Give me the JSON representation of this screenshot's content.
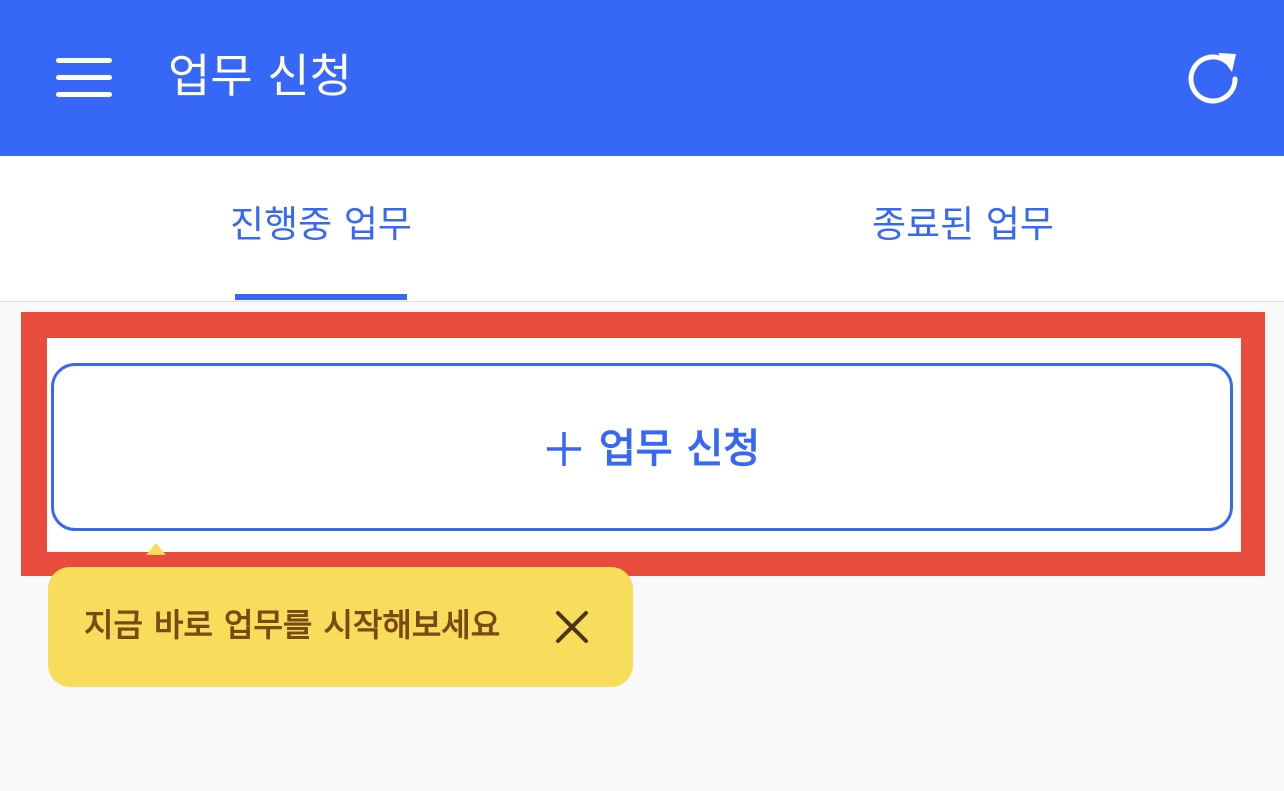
{
  "colors": {
    "primary": "#3767f6",
    "tooltip_background": "#f8dc5c",
    "tooltip_text": "#7a4a15",
    "highlight_frame": "#e74c3c"
  },
  "header": {
    "menu_icon": "hamburger-menu-icon",
    "title": "업무 신청",
    "refresh_icon": "refresh-icon"
  },
  "tabs": [
    {
      "label": "진행중 업무",
      "active": true
    },
    {
      "label": "종료된 업무",
      "active": false
    }
  ],
  "main": {
    "request_button": {
      "icon": "plus-icon",
      "label": "업무 신청"
    },
    "tooltip": {
      "text": "지금 바로 업무를 시작해보세요",
      "close_icon": "close-icon"
    }
  }
}
